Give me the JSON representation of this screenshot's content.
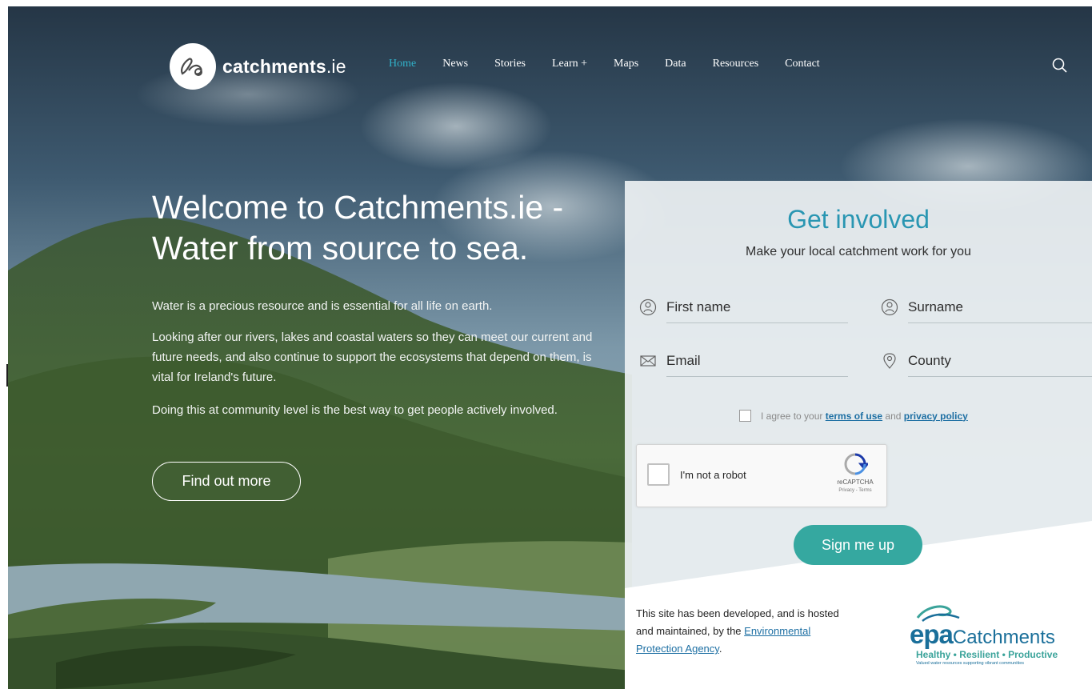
{
  "brand": {
    "name": "catchments",
    "tld": ".ie"
  },
  "nav": {
    "items": [
      {
        "label": "Home",
        "active": true
      },
      {
        "label": "News"
      },
      {
        "label": "Stories"
      },
      {
        "label": "Learn +"
      },
      {
        "label": "Maps"
      },
      {
        "label": "Data"
      },
      {
        "label": "Resources"
      },
      {
        "label": "Contact"
      }
    ],
    "search_icon": "search-icon"
  },
  "hero": {
    "title": "Welcome to Catchments.ie - Water from source to sea.",
    "paragraphs": [
      "Water is a precious resource and is essential for all life on earth.",
      "Looking after our rivers, lakes and coastal waters so they can meet our current and future needs, and also continue to support the ecosystems that depend on them, is vital for Ireland's future.",
      "Doing this at community level is the best way to get people actively involved."
    ],
    "cta_label": "Find out more"
  },
  "form": {
    "title": "Get involved",
    "subtitle": "Make your local catchment work for you",
    "fields": {
      "first_name": {
        "placeholder": "First name",
        "value": ""
      },
      "surname": {
        "placeholder": "Surname",
        "value": ""
      },
      "email": {
        "placeholder": "Email",
        "value": ""
      },
      "county": {
        "placeholder": "County",
        "value": ""
      }
    },
    "agree": {
      "prefix": "I agree to your ",
      "terms": "terms of use",
      "middle": " and ",
      "privacy": "privacy policy",
      "checked": false
    },
    "captcha": {
      "label": "I'm not a robot",
      "brand": "reCAPTCHA",
      "links": "Privacy - Terms"
    },
    "submit_label": "Sign me up"
  },
  "footer": {
    "note_prefix": "This site has been developed, and is hosted and maintained, by the ",
    "note_link": "Environmental Protection Agency",
    "note_suffix": "."
  },
  "epa_logo": {
    "mark": "epa",
    "word": "Catchments",
    "tagline": "Healthy • Resilient • Productive",
    "small": "Valued water resources supporting vibrant communities"
  },
  "colors": {
    "accent": "#31b1c9",
    "title_blue": "#2996b2",
    "button_teal": "#35a8a0",
    "link_blue": "#1d6fa3"
  }
}
